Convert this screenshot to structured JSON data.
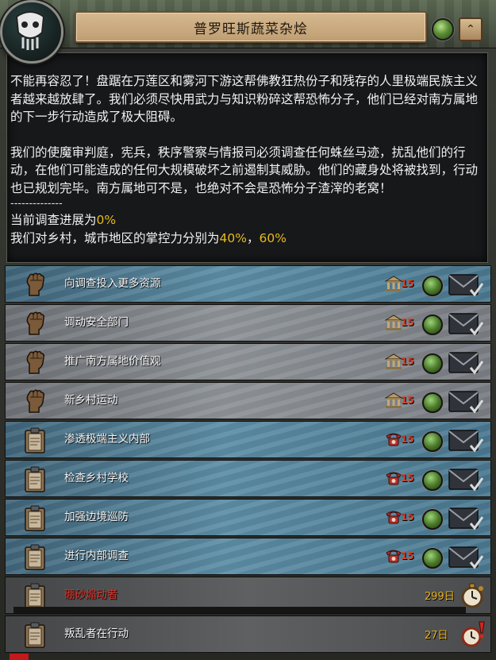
{
  "window": {
    "title": "普罗旺斯蔬菜杂烩",
    "collapse_glyph": "⌃",
    "emblem_icon": "mask-emblem-icon"
  },
  "description": {
    "paragraph1": "不能再容忍了！盘踞在万莲区和雾河下游这帮佛教狂热份子和残存的人里极端民族主义者越来越放肆了。我们必须尽快用武力与知识粉碎这帮恐怖分子，他们已经对南方属地的下一步行动造成了极大阻碍。",
    "paragraph2": "我们的使魔审判庭，宪兵，秩序警察与情报司必须调查任何蛛丝马迹，扰乱他们的行动，在他们可能造成的任何大规模破坏之前遏制其威胁。他们的藏身处将被找到，行动也已规划完毕。南方属地可不是，也绝对不会是恐怖分子渣滓的老窝！",
    "separator": "--------------",
    "progress_prefix": "当前调查进展为",
    "progress_value": "0%",
    "control_prefix": "我们对乡村，城市地区的掌控力分别为",
    "control_rural": "40%",
    "control_sep": "，",
    "control_urban": "60%"
  },
  "decisions": [
    {
      "label": "向调查投入更多资源",
      "cost": "15",
      "cost_icon": "building-icon",
      "icon": "fist-icon",
      "style": "blue"
    },
    {
      "label": "调动安全部门",
      "cost": "15",
      "cost_icon": "building-icon",
      "icon": "fist-icon",
      "style": "gray"
    },
    {
      "label": "推广南方属地价值观",
      "cost": "15",
      "cost_icon": "building-icon",
      "icon": "fist-icon",
      "style": "gray"
    },
    {
      "label": "新乡村运动",
      "cost": "15",
      "cost_icon": "building-icon",
      "icon": "fist-icon",
      "style": "gray"
    },
    {
      "label": "渗透极端主义内部",
      "cost": "15",
      "cost_icon": "phone-icon",
      "icon": "clipboard-icon",
      "style": "blue"
    },
    {
      "label": "检查乡村学校",
      "cost": "15",
      "cost_icon": "phone-icon",
      "icon": "clipboard-icon",
      "style": "blue"
    },
    {
      "label": "加强边境巡防",
      "cost": "15",
      "cost_icon": "phone-icon",
      "icon": "clipboard-icon",
      "style": "blue"
    },
    {
      "label": "进行内部调查",
      "cost": "15",
      "cost_icon": "phone-icon",
      "icon": "clipboard-icon",
      "style": "blue"
    }
  ],
  "missions": [
    {
      "label": "硼砂煽动者",
      "days": "299日",
      "icon": "clipboard-icon",
      "timer_icon": "stopwatch-icon",
      "progress": 0.0
    },
    {
      "label": "叛乱者在行动",
      "days": "27日",
      "icon": "clipboard-icon",
      "timer_icon": "stopwatch-alert-icon"
    }
  ],
  "colors": {
    "accent_yellow": "#e6bb1c",
    "cost_red": "#d2452f",
    "mission_red": "#d8332a",
    "row_blue": "#5d8ea6",
    "row_gray": "#90959a"
  }
}
